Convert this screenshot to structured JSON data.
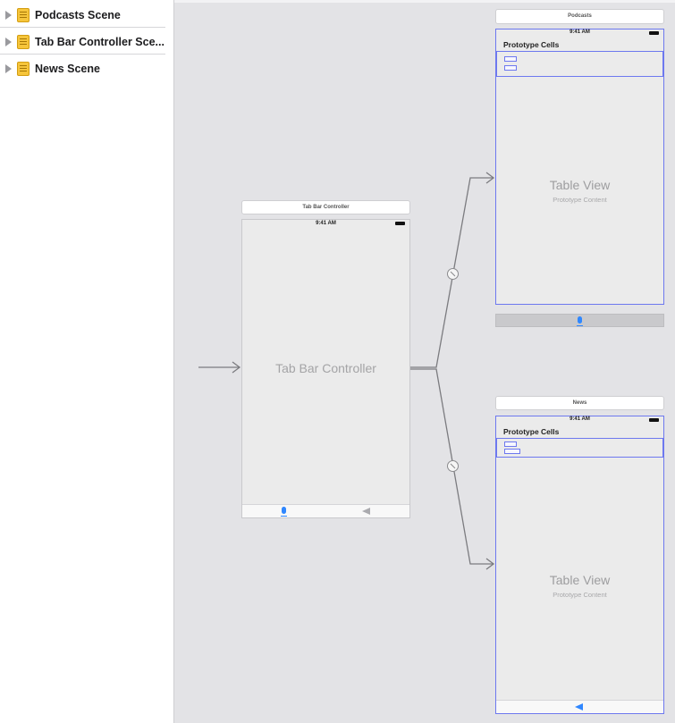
{
  "outline": {
    "items": [
      {
        "label": "Podcasts Scene",
        "icon": "scene-icon"
      },
      {
        "label": "Tab Bar Controller Sce...",
        "icon": "scene-icon"
      },
      {
        "label": "News Scene",
        "icon": "scene-icon"
      }
    ]
  },
  "canvas": {
    "tab_bar_controller": {
      "title": "Tab Bar Controller",
      "time": "9:41 AM",
      "center_label": "Tab Bar Controller",
      "tab_icons": [
        "microphone-icon",
        "megaphone-icon"
      ]
    },
    "podcasts": {
      "title": "Podcasts",
      "time": "9:41 AM",
      "header": "Prototype Cells",
      "table_title": "Table View",
      "table_sub": "Prototype Content",
      "tab_icon": "microphone-icon"
    },
    "news": {
      "title": "News",
      "time": "9:41 AM",
      "header": "Prototype Cells",
      "table_title": "Table View",
      "table_sub": "Prototype Content",
      "tab_icon": "megaphone-icon"
    }
  },
  "colors": {
    "accent": "#2f87ff",
    "selection": "#6d78ef",
    "scene_icon": "#f6c53b",
    "canvas_bg": "#e3e3e6"
  }
}
